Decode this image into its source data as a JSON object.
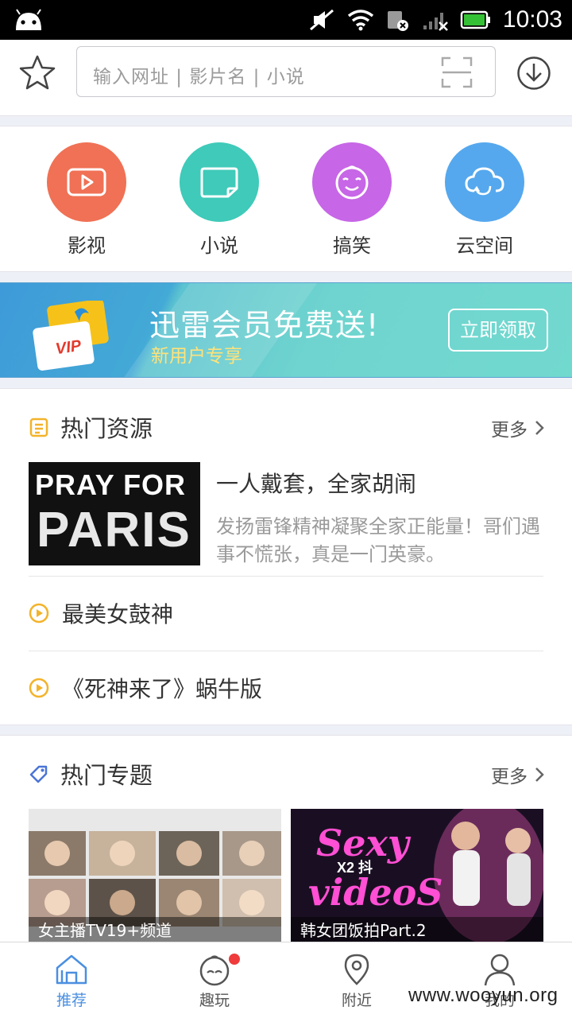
{
  "status_bar": {
    "time": "10:03"
  },
  "search": {
    "placeholder": "输入网址 | 影片名 | 小说"
  },
  "quick_links": [
    {
      "label": "影视",
      "color": "#f07155",
      "icon": "play-video-icon"
    },
    {
      "label": "小说",
      "color": "#3fcab9",
      "icon": "book-icon"
    },
    {
      "label": "搞笑",
      "color": "#c766e6",
      "icon": "smiley-icon"
    },
    {
      "label": "云空间",
      "color": "#55a8ee",
      "icon": "cloud-icon"
    }
  ],
  "banner": {
    "card_text": "VIP",
    "title": "迅雷会员免费送!",
    "subtitle": "新用户专享",
    "button": "立即领取"
  },
  "hot_resources": {
    "title": "热门资源",
    "more": "更多",
    "featured": {
      "image_line1": "PRAY FOR",
      "image_line2": "PARIS",
      "title": "一人戴套，全家胡闹",
      "description": "发扬雷锋精神凝聚全家正能量！哥们遇事不慌张，真是一门英豪。"
    },
    "items": [
      {
        "title": "最美女鼓神"
      },
      {
        "title": "《死神来了》蜗牛版"
      }
    ]
  },
  "hot_topics": {
    "title": "热门专题",
    "more": "更多",
    "items": [
      {
        "caption": "女主播TV19+频道"
      },
      {
        "caption": "韩女团饭拍Part.2",
        "art_line1": "Sexy",
        "art_line2": "videoS",
        "art_badge": "X2 抖"
      }
    ]
  },
  "tab_bar": [
    {
      "label": "推荐",
      "active": true
    },
    {
      "label": "趣玩",
      "active": false,
      "badge": true
    },
    {
      "label": "附近",
      "active": false
    },
    {
      "label": "我的",
      "active": false
    }
  ],
  "watermark": "www.wooyun.org",
  "colors": {
    "accent": "#4a8fe0",
    "tip": "#f3b32a"
  }
}
